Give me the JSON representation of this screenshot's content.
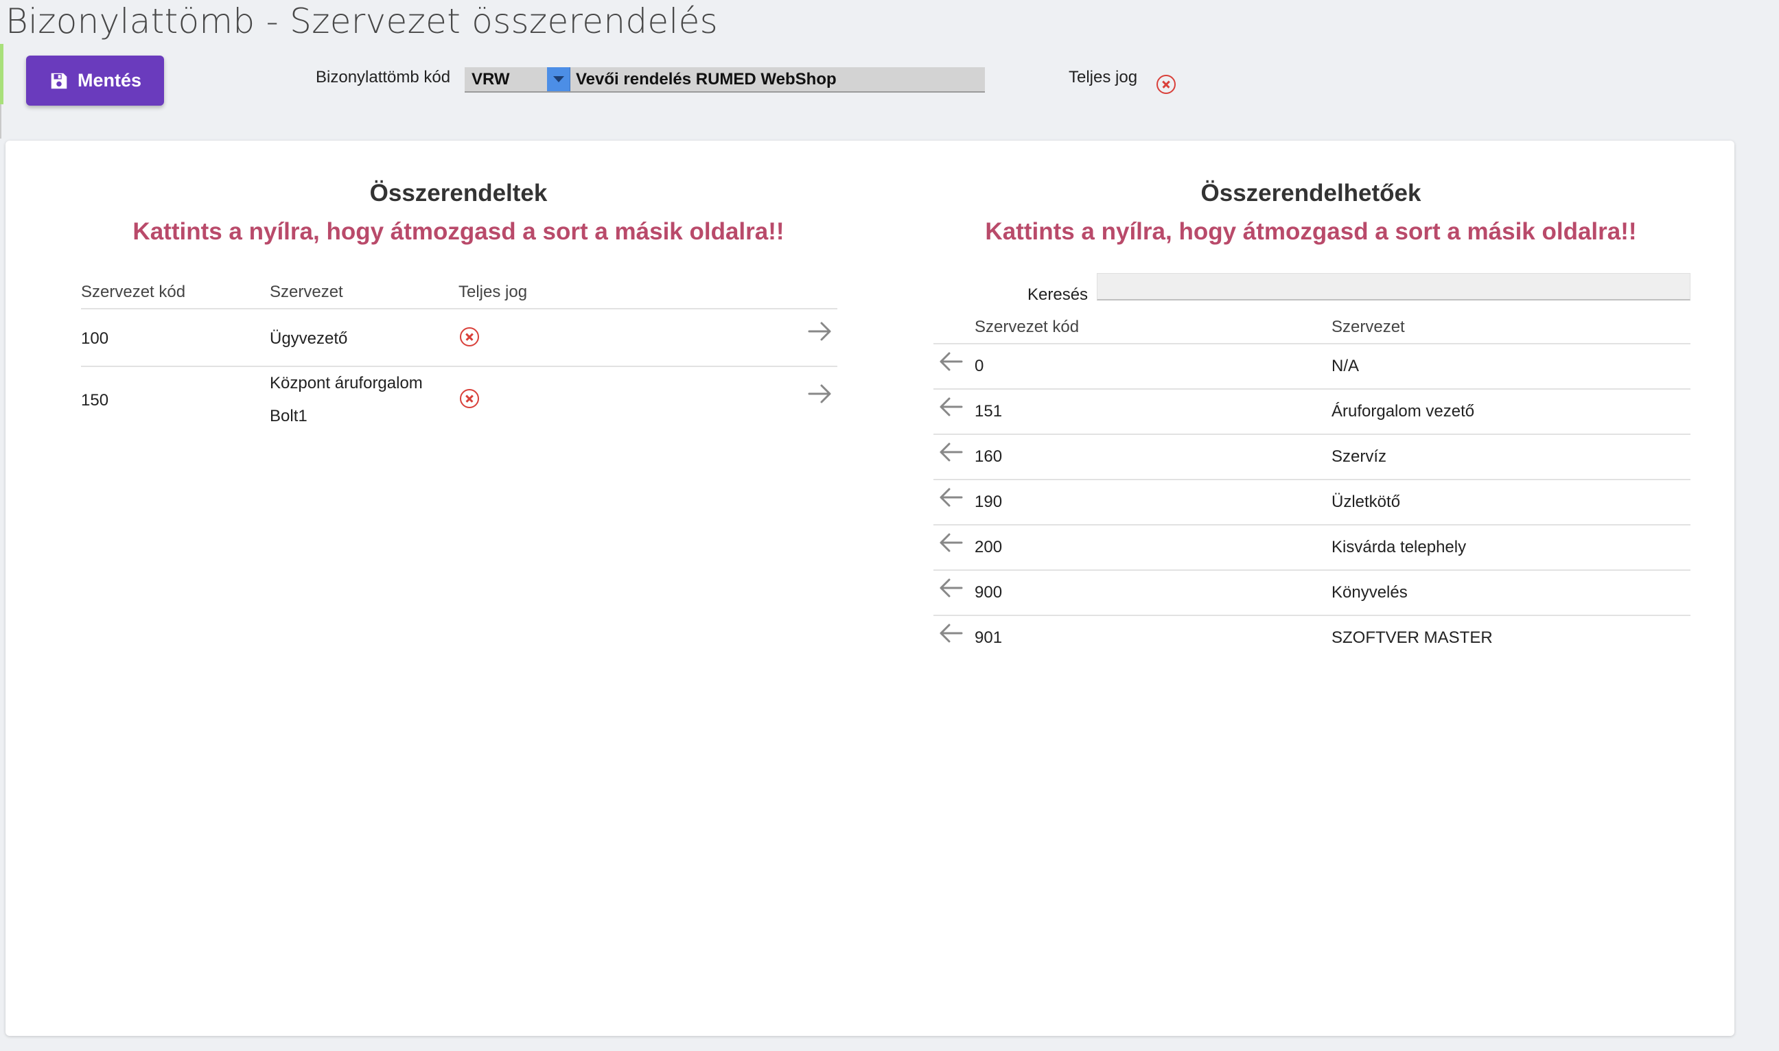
{
  "page": {
    "title": "Bizonylattömb - Szervezet összerendelés"
  },
  "toolbar": {
    "save_label": "Mentés",
    "block_code_label": "Bizonylattömb kód",
    "block_code_value": "VRW",
    "block_name_value": "Vevői rendelés RUMED WebShop",
    "full_right_label": "Teljes jog",
    "full_right_icon": "x-circle-icon"
  },
  "assigned": {
    "title": "Összerendeltek",
    "hint": "Kattints a nyílra, hogy átmozgasd a sort a másik oldalra!!",
    "columns": [
      "Szervezet kód",
      "Szervezet",
      "Teljes jog"
    ],
    "rows": [
      {
        "code": "100",
        "name_line1": "Ügyvezető",
        "name_line2": ""
      },
      {
        "code": "150",
        "name_line1": "Központ áruforgalom",
        "name_line2": "Bolt1"
      }
    ]
  },
  "available": {
    "title": "Összerendelhetőek",
    "hint": "Kattints a nyílra, hogy átmozgasd a sort a másik oldalra!!",
    "search_label": "Keresés",
    "search_value": "",
    "columns": [
      "Szervezet kód",
      "Szervezet"
    ],
    "rows": [
      {
        "code": "0",
        "name": "N/A"
      },
      {
        "code": "151",
        "name": "Áruforgalom vezető"
      },
      {
        "code": "160",
        "name": "Szervíz"
      },
      {
        "code": "190",
        "name": "Üzletkötő"
      },
      {
        "code": "200",
        "name": "Kisvárda telephely"
      },
      {
        "code": "900",
        "name": "Könyvelés"
      },
      {
        "code": "901",
        "name": "SZOFTVER MASTER"
      }
    ]
  },
  "colors": {
    "accent": "#6a3bbd",
    "hint": "#b94a6a",
    "danger": "#d9403a",
    "dropdown": "#4c8ee6"
  }
}
